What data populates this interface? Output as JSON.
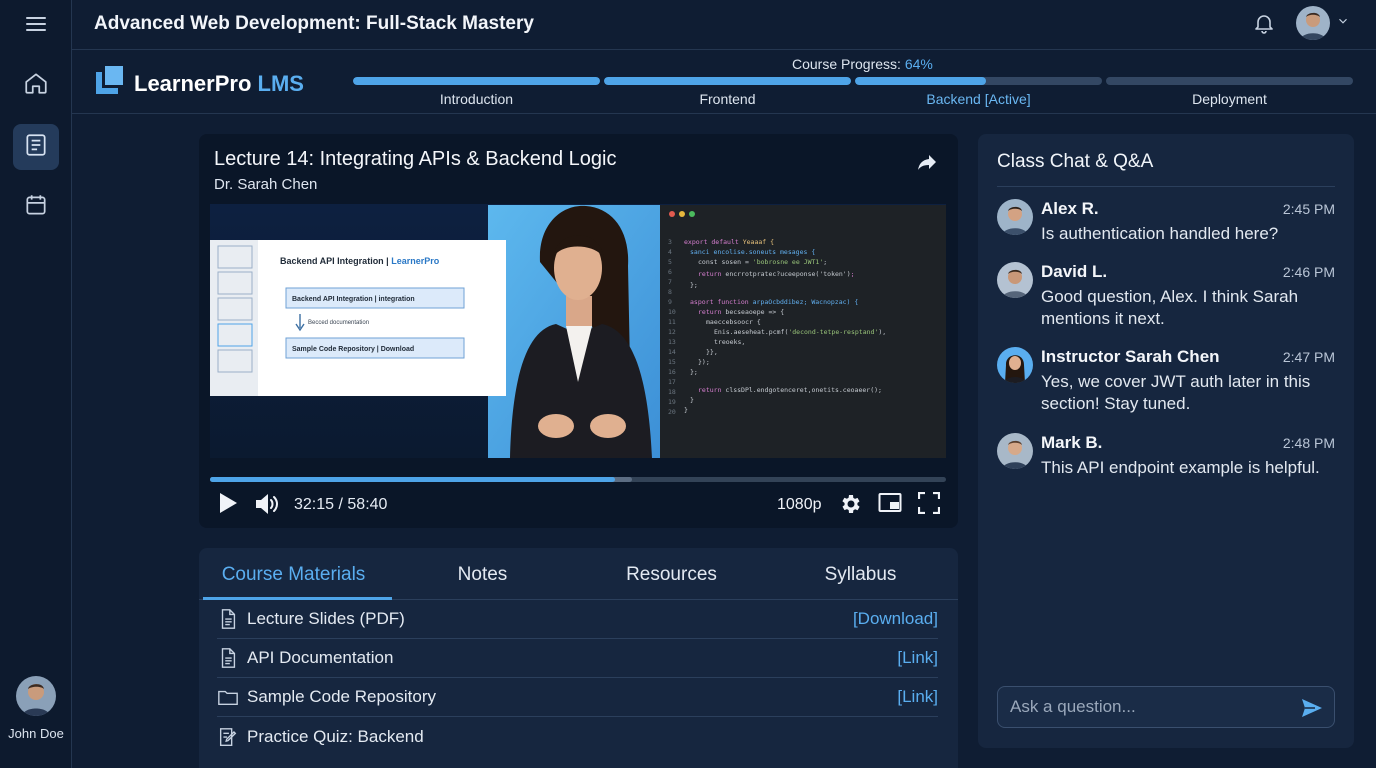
{
  "header": {
    "course_title": "Advanced Web Development: Full-Stack Mastery",
    "user_menu_icon": "chevron-down-icon"
  },
  "sidebar": {
    "items": [
      {
        "icon": "home-icon",
        "active": false
      },
      {
        "icon": "book-icon",
        "active": true
      },
      {
        "icon": "calendar-icon",
        "active": false
      }
    ],
    "user_name": "John Doe"
  },
  "brand": {
    "name": "LearnerPro",
    "suffix": "LMS"
  },
  "progress": {
    "label": "Course Progress:",
    "percent_text": "64%",
    "percent": 64,
    "segments": [
      {
        "label": "Introduction",
        "fill": 1.0,
        "active": false
      },
      {
        "label": "Frontend",
        "fill": 1.0,
        "active": false
      },
      {
        "label": "Backend [Active]",
        "fill": 0.53,
        "active": true
      },
      {
        "label": "Deployment",
        "fill": 0.0,
        "active": false
      }
    ]
  },
  "video": {
    "lecture_title": "Lecture 14: Integrating APIs & Backend Logic",
    "instructor": "Dr. Sarah Chen",
    "time_current": "32:15",
    "time_separator": "/",
    "time_total": "58:40",
    "quality": "1080p",
    "played_fraction": 0.55,
    "buffered_fraction": 0.574,
    "slide": {
      "title": "Backend API Integration | LearnerPro",
      "title_main": "Backend API Integration | ",
      "title_brand": "LearnerPro",
      "box1": "Backend API Integration | integration",
      "arrow_note": "Becced documentation",
      "box2": "Sample Code Repository | Download"
    }
  },
  "materials": {
    "tabs": [
      {
        "label": "Course Materials",
        "active": true
      },
      {
        "label": "Notes",
        "active": false
      },
      {
        "label": "Resources",
        "active": false
      },
      {
        "label": "Syllabus",
        "active": false
      }
    ],
    "items": [
      {
        "icon": "document-icon",
        "name": "Lecture Slides (PDF)",
        "link": "[Download]"
      },
      {
        "icon": "document-icon",
        "name": "API Documentation",
        "link": "[Link]"
      },
      {
        "icon": "folder-icon",
        "name": "Sample Code Repository",
        "link": "[Link]"
      },
      {
        "icon": "quiz-edit-icon",
        "name": "Practice Quiz: Backend",
        "link": ""
      }
    ]
  },
  "chat": {
    "title": "Class Chat & Q&A",
    "messages": [
      {
        "author": "Alex R.",
        "time": "2:45 PM",
        "text": "Is authentication handled here?"
      },
      {
        "author": "David L.",
        "time": "2:46 PM",
        "text": "Good question, Alex. I think Sarah mentions it next."
      },
      {
        "author": "Instructor Sarah Chen",
        "time": "2:47 PM",
        "text": "Yes, we cover JWT auth later in this section! Stay tuned."
      },
      {
        "author": "Mark B.",
        "time": "2:48 PM",
        "text": "This API endpoint example is helpful."
      }
    ],
    "input_placeholder": "Ask a question..."
  },
  "colors": {
    "accent": "#4ea4e8",
    "background": "#0f1d33",
    "panel": "#16263f"
  }
}
